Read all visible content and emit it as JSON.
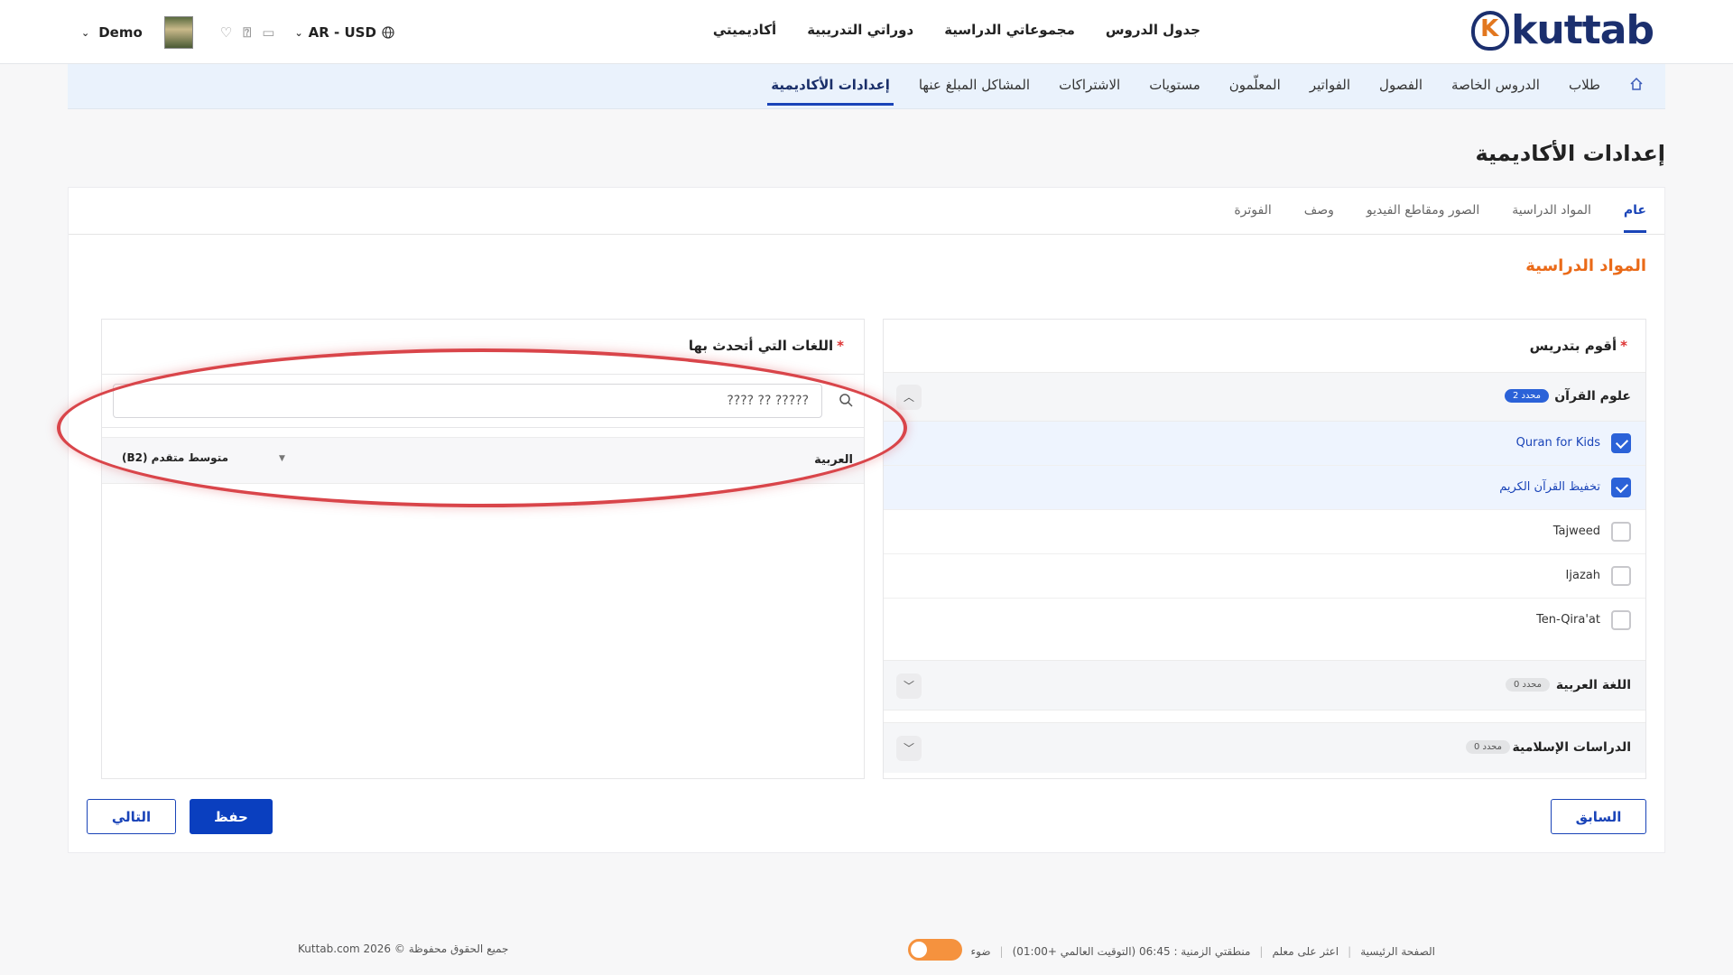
{
  "brand": {
    "name": "kuttab"
  },
  "main_nav": [
    "جدول الدروس",
    "مجموعاتي الدراسية",
    "دوراتي التدريبية",
    "أكاديميتي"
  ],
  "header": {
    "currency": "AR - USD",
    "user_name": "Demo"
  },
  "sub_nav": {
    "items": [
      "طلاب",
      "الدروس الخاصة",
      "الفصول",
      "الفواتير",
      "المعلّمون",
      "مستويات",
      "الاشتراكات",
      "المشاكل المبلغ عنها",
      "إعدادات الأكاديمية"
    ],
    "active_index": 8
  },
  "page_title": "إعدادات الأكاديمية",
  "tabs": {
    "items": [
      "عام",
      "المواد الدراسية",
      "الصور ومقاطع الفيديو",
      "وصف",
      "الفوترة"
    ],
    "active_index": 0
  },
  "section_title": "المواد الدراسية",
  "subjects_panel": {
    "label": "أقوم بتدريس",
    "required_mark": "*",
    "groups": [
      {
        "name": "علوم القرآن",
        "badge": "2 محدد",
        "expanded": true,
        "items": [
          {
            "label": "Quran for Kids",
            "checked": true
          },
          {
            "label": "تخفيظ القرآن الكريم",
            "checked": true
          },
          {
            "label": "Tajweed",
            "checked": false
          },
          {
            "label": "Ijazah",
            "checked": false
          },
          {
            "label": "Ten-Qira'at",
            "checked": false
          }
        ]
      },
      {
        "name": "اللغة العربية",
        "badge": "0 محدد",
        "expanded": false
      },
      {
        "name": "الدراسات الإسلامية",
        "badge": "0 محدد",
        "expanded": false
      }
    ]
  },
  "languages_panel": {
    "label": "اللغات التي أتحدث بها",
    "required_mark": "*",
    "search_value": "????? ?? ????",
    "rows": [
      {
        "language": "العربية",
        "level": "متوسط متقدم (B2)"
      }
    ]
  },
  "buttons": {
    "prev": "السابق",
    "save": "حفظ",
    "next": "التالي"
  },
  "footer": {
    "home": "الصفحة الرئيسية",
    "find_teacher": "اعثر على معلم",
    "timezone": "منطقتي الزمنية : 06:45 (التوقيت العالمي +01:00)",
    "theme_label": "ضوء",
    "copyright": "جميع الحقوق محفوظة © 2026 Kuttab.com"
  },
  "colors": {
    "accent": "#1a44b8",
    "section_title": "#ea6a18",
    "highlight": "#d9454a",
    "toggle": "#f5923e"
  }
}
